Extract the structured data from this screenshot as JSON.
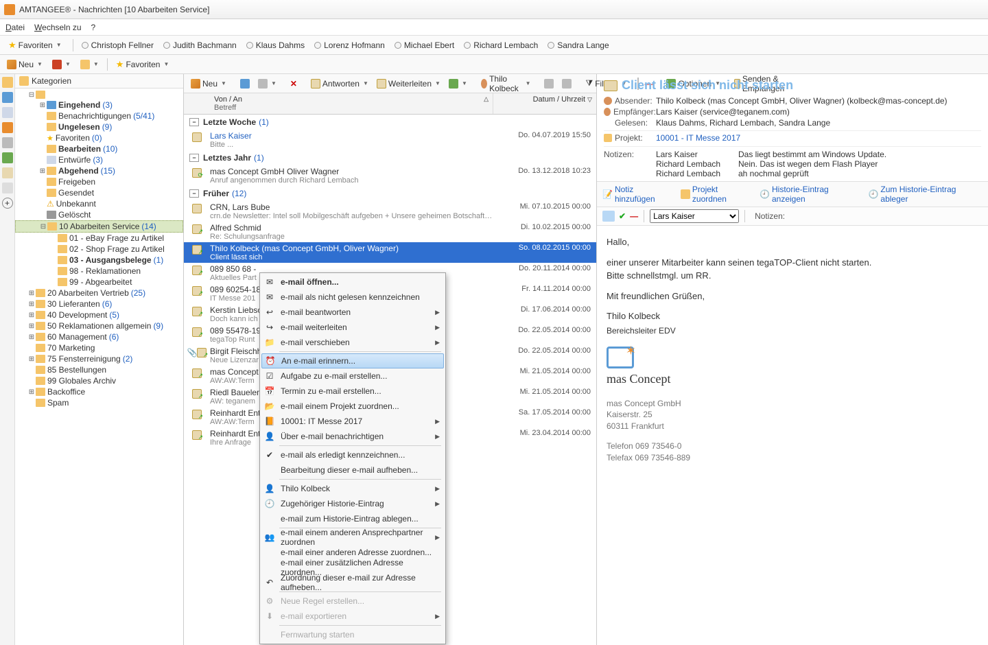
{
  "title": "AMTANGEE®  - Nachrichten [10 Abarbeiten Service]",
  "menu": {
    "datei": "Datei",
    "wechseln": "Wechseln zu",
    "help": "?"
  },
  "favbar": {
    "favoriten": "Favoriten",
    "people": [
      "Christoph Fellner",
      "Judith Bachmann",
      "Klaus Dahms",
      "Lorenz Hofmann",
      "Michael Ebert",
      "Richard Lembach",
      "Sandra Lange"
    ]
  },
  "tb1": {
    "neu": "Neu",
    "fav": "Favoriten"
  },
  "tree": {
    "header": "Kategorien",
    "items": [
      {
        "ind": 1,
        "exp": "⊟",
        "ico": "#f5c56a",
        "lbl": "",
        "b": "",
        "cnt": ""
      },
      {
        "ind": 2,
        "exp": "⊞",
        "ico": "#5b9bd5",
        "lbl": "",
        "b": "Eingehend",
        "cnt": "(3)"
      },
      {
        "ind": 2,
        "exp": "",
        "ico": "#f5c56a",
        "lbl": "Benachrichtigungen ",
        "b": "",
        "cnt": "(5/41)"
      },
      {
        "ind": 2,
        "exp": "",
        "ico": "#f5c56a",
        "lbl": "",
        "b": "Ungelesen",
        "cnt": "(9)"
      },
      {
        "ind": 2,
        "exp": "",
        "ico": "#f5d65a",
        "lbl": "Favoriten ",
        "b": "",
        "cnt": "(0)",
        "star": true
      },
      {
        "ind": 2,
        "exp": "",
        "ico": "#f5c56a",
        "lbl": "",
        "b": "Bearbeiten",
        "cnt": "(10)"
      },
      {
        "ind": 2,
        "exp": "",
        "ico": "#cfd8e8",
        "lbl": "Entwürfe ",
        "b": "",
        "cnt": "(3)"
      },
      {
        "ind": 2,
        "exp": "⊞",
        "ico": "#f5c56a",
        "lbl": "",
        "b": "Abgehend",
        "cnt": "(15)"
      },
      {
        "ind": 2,
        "exp": "",
        "ico": "#f5c56a",
        "lbl": "Freigeben",
        "b": "",
        "cnt": ""
      },
      {
        "ind": 2,
        "exp": "",
        "ico": "#f5c56a",
        "lbl": "Gesendet",
        "b": "",
        "cnt": ""
      },
      {
        "ind": 2,
        "exp": "",
        "ico": "#f5d65a",
        "lbl": "Unbekannt",
        "b": "",
        "cnt": "",
        "warn": true
      },
      {
        "ind": 2,
        "exp": "",
        "ico": "#999",
        "lbl": "Gelöscht",
        "b": "",
        "cnt": ""
      },
      {
        "ind": 2,
        "exp": "⊟",
        "ico": "#f5c56a",
        "lbl": "10 Abarbeiten Service ",
        "b": "",
        "cnt": "(14)",
        "sel": true
      },
      {
        "ind": 3,
        "exp": "",
        "ico": "#f5c56a",
        "lbl": "01 - eBay Frage zu Artikel",
        "b": "",
        "cnt": ""
      },
      {
        "ind": 3,
        "exp": "",
        "ico": "#f5c56a",
        "lbl": "02 - Shop Frage zu Artikel",
        "b": "",
        "cnt": ""
      },
      {
        "ind": 3,
        "exp": "",
        "ico": "#f5c56a",
        "lbl": "",
        "b": "03 - Ausgangsbelege",
        "cnt": "(1)"
      },
      {
        "ind": 3,
        "exp": "",
        "ico": "#f5c56a",
        "lbl": "98 - Reklamationen",
        "b": "",
        "cnt": ""
      },
      {
        "ind": 3,
        "exp": "",
        "ico": "#f5c56a",
        "lbl": "99 - Abgearbeitet",
        "b": "",
        "cnt": ""
      },
      {
        "ind": 1,
        "exp": "⊞",
        "ico": "#f5c56a",
        "lbl": "20 Abarbeiten Vertrieb ",
        "b": "",
        "cnt": "(25)"
      },
      {
        "ind": 1,
        "exp": "⊞",
        "ico": "#f5c56a",
        "lbl": "30 Lieferanten ",
        "b": "",
        "cnt": "(6)"
      },
      {
        "ind": 1,
        "exp": "⊞",
        "ico": "#f5c56a",
        "lbl": "40 Development ",
        "b": "",
        "cnt": "(5)"
      },
      {
        "ind": 1,
        "exp": "⊞",
        "ico": "#f5c56a",
        "lbl": "50 Reklamationen allgemein ",
        "b": "",
        "cnt": "(9)"
      },
      {
        "ind": 1,
        "exp": "⊞",
        "ico": "#f5c56a",
        "lbl": "60 Management ",
        "b": "",
        "cnt": "(6)"
      },
      {
        "ind": 1,
        "exp": "",
        "ico": "#f5c56a",
        "lbl": "70 Marketing",
        "b": "",
        "cnt": ""
      },
      {
        "ind": 1,
        "exp": "⊞",
        "ico": "#f5c56a",
        "lbl": "75 Fensterreinigung ",
        "b": "",
        "cnt": "(2)"
      },
      {
        "ind": 1,
        "exp": "",
        "ico": "#f5c56a",
        "lbl": "85 Bestellungen",
        "b": "",
        "cnt": ""
      },
      {
        "ind": 1,
        "exp": "",
        "ico": "#f5c56a",
        "lbl": "99 Globales Archiv",
        "b": "",
        "cnt": ""
      },
      {
        "ind": 1,
        "exp": "⊞",
        "ico": "#f5c56a",
        "lbl": "Backoffice",
        "b": "",
        "cnt": ""
      },
      {
        "ind": 1,
        "exp": "",
        "ico": "#f5c56a",
        "lbl": "Spam",
        "b": "",
        "cnt": ""
      }
    ]
  },
  "listTb": {
    "neu": "Neu",
    "antworten": "Antworten",
    "weiterleiten": "Weiterleiten",
    "user": "Thilo Kolbeck",
    "filtern": "Filtern",
    "optionen": "Optionen",
    "senden": "Senden & Empfangen"
  },
  "listHdr": {
    "from": "Von / An",
    "subj": "Betreff",
    "date": "Datum / Uhrzeit"
  },
  "groups": [
    {
      "title": "Letzte Woche",
      "count": "(1)",
      "rows": [
        {
          "from": "Lars Kaiser",
          "sub": "Bitte ...",
          "date": "Do.  04.07.2019  15:50",
          "link": true,
          "ico": "mail"
        }
      ]
    },
    {
      "title": "Letztes Jahr",
      "count": "(1)",
      "rows": [
        {
          "from": "mas Concept GmbH Oliver Wagner",
          "sub": "Anruf angenommen durch Richard Lembach",
          "date": "Do.  13.12.2018  10:23",
          "ico": "mail-in"
        }
      ]
    },
    {
      "title": "Früher",
      "count": "(12)",
      "rows": [
        {
          "from": "CRN, Lars Bube",
          "sub": "crn.de Newsletter: Intel soll Mobilgeschäft aufgeben + Unsere geheimen Botschaften + Bestes Produkt-Design",
          "date": "Mi.  07.10.2015  00:00",
          "ico": "mail"
        },
        {
          "from": "Alfred Schmid",
          "sub": "Re: Schulungsanfrage",
          "date": "Di.  10.02.2015  00:00",
          "ico": "mail-out"
        },
        {
          "from": "Thilo Kolbeck (mas Concept GmbH, Oliver Wagner)",
          "sub": "Client lässt sich",
          "date": "So.  08.02.2015  00:00",
          "sel": true,
          "ico": "mail-out"
        },
        {
          "from": "089 850 68 - ",
          "sub": "Aktuelles Part",
          "date": "Do.  20.11.2014  00:00",
          "ico": "mail-out"
        },
        {
          "from": "089 60254-18",
          "sub": "IT Messe 201",
          "date": "Fr.  14.11.2014  00:00",
          "ico": "mail-out"
        },
        {
          "from": "Kerstin Liebsc",
          "sub": "Doch kann ich",
          "date": "Di.  17.06.2014  00:00",
          "ico": "mail-out"
        },
        {
          "from": "089 55478-19",
          "sub": "tegaTop Runt",
          "date": "Do.  22.05.2014  00:00",
          "ico": "mail-out"
        },
        {
          "from": "Birgit Fleischh",
          "sub": "Neue Lizenzar",
          "date": "Do.  22.05.2014  00:00",
          "ico": "mail-out",
          "clip": true
        },
        {
          "from": "mas Concept ",
          "sub": "AW:AW:Term",
          "date": "Mi.  21.05.2014  00:00",
          "ico": "mail-out"
        },
        {
          "from": "Riedl Bauelem",
          "sub": "AW: teganem",
          "date": "Mi.  21.05.2014  00:00",
          "ico": "mail-out"
        },
        {
          "from": "Reinhardt Ent",
          "sub": "AW:AW:Term",
          "date": "Sa.  17.05.2014  00:00",
          "ico": "mail-out"
        },
        {
          "from": "Reinhardt Ent",
          "sub": "Ihre Anfrage ",
          "date": "Mi.  23.04.2014  00:00",
          "ico": "mail-out"
        }
      ]
    }
  ],
  "ctx": [
    {
      "lbl": "e-mail öffnen...",
      "b": true,
      "ico": "mail"
    },
    {
      "lbl": "e-mail als nicht gelesen kennzeichnen",
      "ico": "mail"
    },
    {
      "lbl": "e-mail beantworten",
      "arr": true,
      "ico": "reply"
    },
    {
      "lbl": "e-mail weiterleiten",
      "arr": true,
      "ico": "fwd"
    },
    {
      "lbl": "e-mail verschieben",
      "arr": true,
      "ico": "move"
    },
    {
      "sep": true
    },
    {
      "lbl": "An e-mail erinnern...",
      "hl": true,
      "ico": "remind"
    },
    {
      "lbl": "Aufgabe zu e-mail erstellen...",
      "ico": "task"
    },
    {
      "lbl": "Termin zu e-mail erstellen...",
      "ico": "cal"
    },
    {
      "lbl": "e-mail einem Projekt zuordnen...",
      "ico": "proj"
    },
    {
      "lbl": "10001: IT Messe 2017",
      "arr": true,
      "ico": "proj2"
    },
    {
      "lbl": "Über e-mail benachrichtigen",
      "arr": true,
      "ico": "notify"
    },
    {
      "sep": true
    },
    {
      "lbl": "e-mail als erledigt kennzeichnen...",
      "ico": "done"
    },
    {
      "lbl": "Bearbeitung dieser e-mail aufheben..."
    },
    {
      "sep": true
    },
    {
      "lbl": "Thilo Kolbeck",
      "arr": true,
      "ico": "user"
    },
    {
      "lbl": "Zugehöriger Historie-Eintrag",
      "arr": true,
      "ico": "hist"
    },
    {
      "lbl": "e-mail zum Historie-Eintrag ablegen..."
    },
    {
      "sep": true
    },
    {
      "lbl": "e-mail einem anderen Ansprechpartner zuordnen",
      "arr": true,
      "ico": "users"
    },
    {
      "lbl": "e-mail einer anderen Adresse zuordnen..."
    },
    {
      "lbl": "e-mail einer zusätzlichen Adresse zuordnen..."
    },
    {
      "lbl": "Zuordnung dieser e-mail zur Adresse aufheben...",
      "ico": "undo"
    },
    {
      "sep": true
    },
    {
      "lbl": "Neue Regel erstellen...",
      "dis": true,
      "ico": "rule"
    },
    {
      "lbl": "e-mail exportieren",
      "arr": true,
      "dis": true,
      "ico": "exp"
    },
    {
      "sep": true
    },
    {
      "lbl": "Fernwartung starten",
      "dis": true
    }
  ],
  "pv": {
    "subject": "Client lässt sich nicht starten",
    "abs_l": "Absender:",
    "abs_v": "Thilo Kolbeck (mas Concept GmbH, Oliver Wagner) (kolbeck@mas-concept.de)",
    "emp_l": "Empfänger:",
    "emp_v": "Lars Kaiser (service@teganem.com)",
    "gel_l": "Gelesen:",
    "gel_v": "Klaus Dahms, Richard Lembach, Sandra Lange",
    "prj_l": "Projekt:",
    "prj_v": "10001 - IT Messe 2017",
    "not_l": "Notizen:",
    "notes": [
      {
        "who": "Lars Kaiser",
        "txt": "Das liegt bestimmt am Windows Update."
      },
      {
        "who": "Richard Lembach",
        "txt": "Nein. Das ist wegen dem Flash Player"
      },
      {
        "who": "Richard Lembach",
        "txt": "ah nochmal geprüft"
      }
    ],
    "act_add": "Notiz hinzufügen",
    "act_proj": "Projekt zuordnen",
    "act_hist": "Historie-Eintrag anzeigen",
    "act_hist2": "Zum Historie-Eintrag ableger",
    "assign_user": "Lars Kaiser",
    "assign_lbl": "Notizen:",
    "body": [
      "Hallo,",
      "einer unserer Mitarbeiter kann seinen tegaTOP-Client nicht starten.\nBitte schnellstmgl. um RR.",
      "Mit freundlichen Grüßen,",
      "Thilo Kolbeck",
      "Bereichsleiter EDV"
    ],
    "company": "mas Concept",
    "addr": [
      "mas Concept GmbH",
      "Kaiserstr. 25",
      "60311 Frankfurt"
    ],
    "tel": [
      "Telefon 069 73546-0",
      "Telefax 069 73546-889"
    ]
  }
}
